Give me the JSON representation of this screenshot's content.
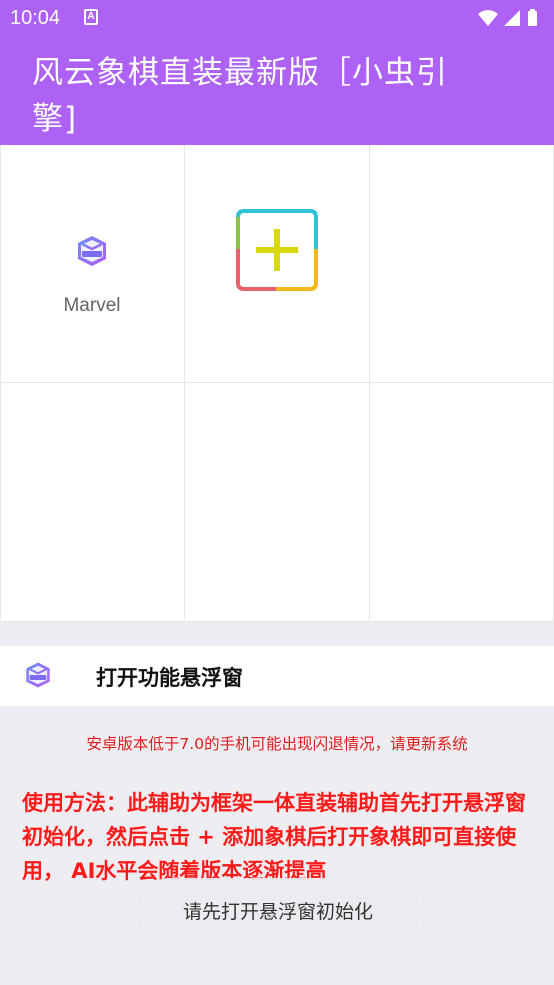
{
  "status_bar": {
    "time": "10:04",
    "notification_icon": "A",
    "icons": [
      "wifi-icon",
      "signal-icon",
      "battery-icon"
    ]
  },
  "app_bar": {
    "title": "风云象棋直装最新版［小虫引擎]",
    "color": "#ad61f5"
  },
  "grid": {
    "items": [
      {
        "label": "Marvel",
        "icon": "marvel-logo-icon"
      },
      {
        "label": "",
        "icon": "add-icon"
      }
    ]
  },
  "float_window": {
    "icon": "marvel-logo-icon",
    "label": "打开功能悬浮窗"
  },
  "info": {
    "warning": "安卓版本低于7.0的手机可能出现闪退情况，请更新系统",
    "usage": "使用方法：此辅助为框架一体直装辅助首先打开悬浮窗初始化，然后点击 + 添加象棋后打开象棋即可直接使用， AI水平会随着版本逐渐提高"
  },
  "toast": {
    "text": "请先打开悬浮窗初始化"
  },
  "colors": {
    "accent": "#ad61f5",
    "warning_red": "#ff1a1a",
    "background": "#eeeef2"
  }
}
